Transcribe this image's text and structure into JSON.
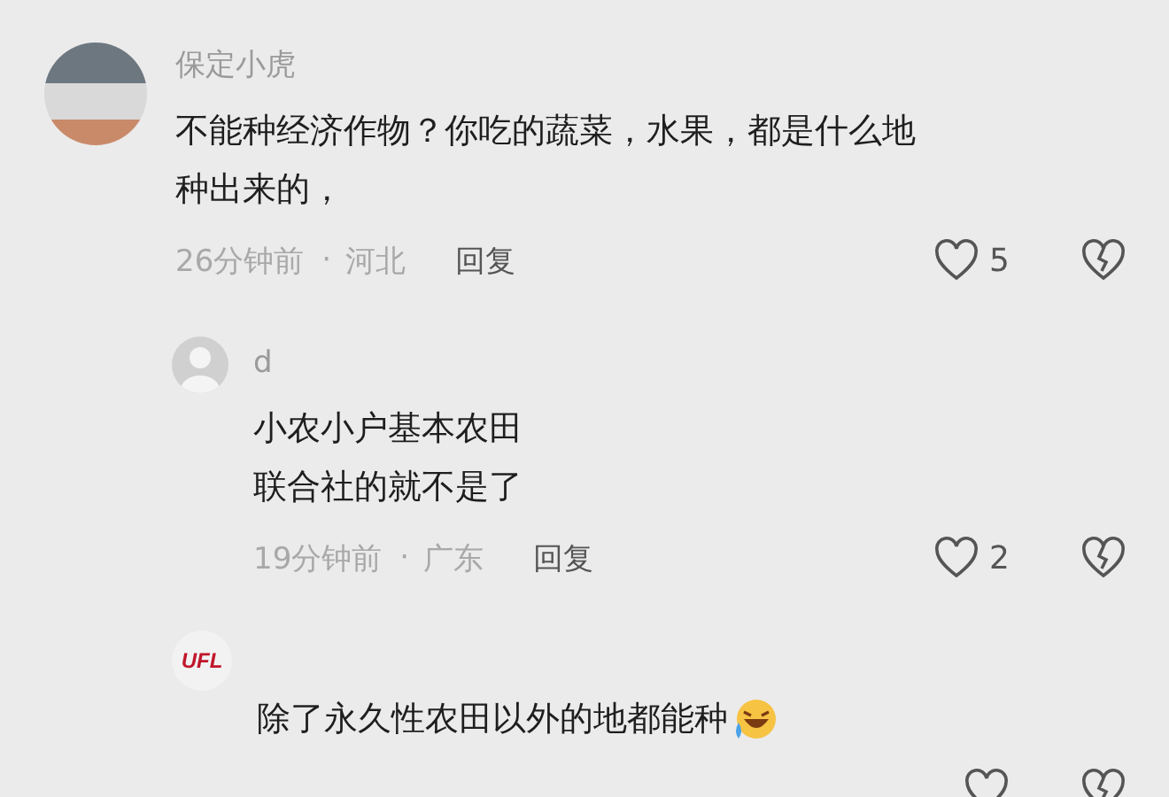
{
  "comments": [
    {
      "kind": "top",
      "avatar": {
        "kind": "photo"
      },
      "name": "保定小虎",
      "text": [
        "不能种经济作物？你吃的蔬菜，水果，都是什么地",
        "种出来的，"
      ],
      "time": "26分钟前",
      "separator": "·",
      "location": "河北",
      "reply": "回复",
      "likes": "5"
    },
    {
      "kind": "reply",
      "avatar": {
        "kind": "default"
      },
      "name": "d",
      "text": [
        "小农小户基本农田",
        "联合社的就不是了"
      ],
      "time": "19分钟前",
      "separator": "·",
      "location": "广东",
      "reply": "回复",
      "likes": "2"
    },
    {
      "kind": "reply",
      "avatar": {
        "kind": "logo"
      },
      "logo": "UFL",
      "text": [
        "除了永久性农田以外的地都能种"
      ],
      "emoji": true
    }
  ]
}
